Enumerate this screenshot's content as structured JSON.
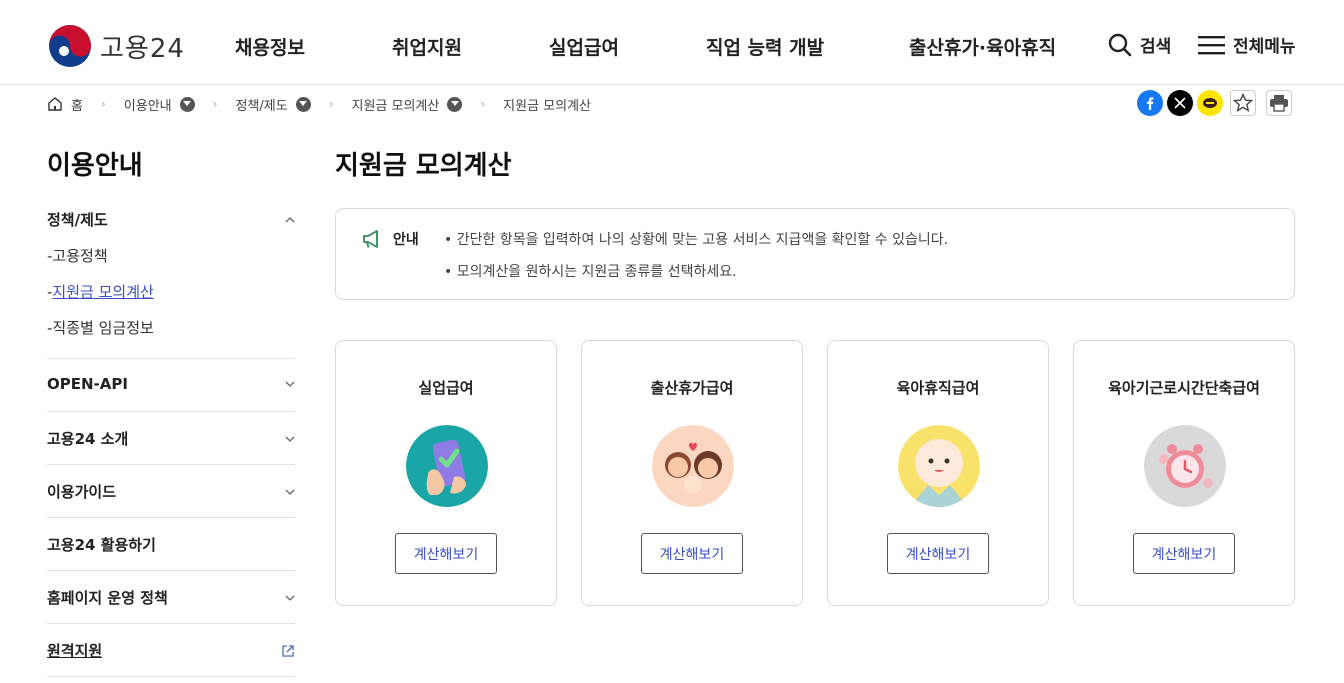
{
  "header": {
    "logo_text": "고용24",
    "nav": [
      "채용정보",
      "취업지원",
      "실업급여",
      "직업 능력 개발",
      "출산휴가·육아휴직"
    ],
    "search_label": "검색",
    "menu_label": "전체메뉴"
  },
  "breadcrumb": [
    "홈",
    "이용안내",
    "정책/제도",
    "지원금 모의계산",
    "지원금 모의계산"
  ],
  "share_icons": [
    "facebook-icon",
    "x-icon",
    "kakaotalk-icon",
    "star-icon",
    "print-icon"
  ],
  "sidebar": {
    "title": "이용안내",
    "groups": [
      {
        "label": "정책/제도",
        "expanded": true,
        "items": [
          "고용정책",
          "지원금 모의계산",
          "직종별 임금정보"
        ],
        "active_item": "지원금 모의계산"
      },
      {
        "label": "OPEN-API"
      },
      {
        "label": "고용24 소개"
      },
      {
        "label": "이용가이드"
      },
      {
        "label": "고용24 활용하기"
      },
      {
        "label": "홈페이지 운영 정책"
      },
      {
        "label": "원격지원",
        "external": true
      }
    ],
    "sub_prefix": "-"
  },
  "main": {
    "title": "지원금 모의계산",
    "notice": {
      "label": "안내",
      "lines": [
        "간단한 항목을 입력하여 나의 상황에 맞는 고용 서비스 지급액을 확인할 수 있습니다.",
        "모의계산을 원하시는 지원금 종류를 선택하세요."
      ]
    },
    "cards": [
      {
        "title": "실업급여",
        "button": "계산해보기"
      },
      {
        "title": "출산휴가급여",
        "button": "계산해보기"
      },
      {
        "title": "육아휴직급여",
        "button": "계산해보기"
      },
      {
        "title": "육아기근로시간단축급여",
        "button": "계산해보기"
      }
    ]
  },
  "colors": {
    "accent_link": "#3a4fc7",
    "logo_red": "#c8102e",
    "logo_blue": "#0f3d8c"
  }
}
